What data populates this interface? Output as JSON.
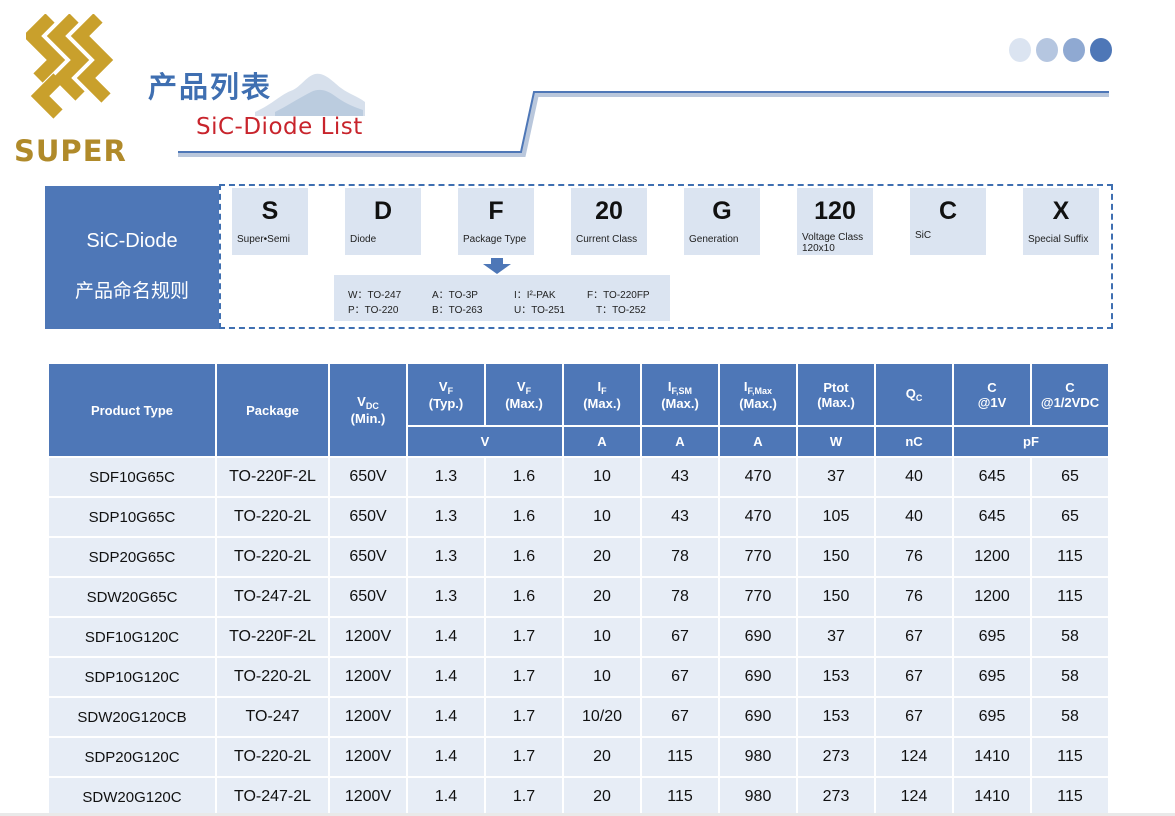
{
  "header": {
    "logo_text": "SUPER",
    "title_cn": "产品列表",
    "title_en": "SiC-Diode  List"
  },
  "colors": {
    "brand_gold": "#c9a02c",
    "primary_blue": "#4e77b7",
    "row_fill": "#e7edf6",
    "title_red": "#c8242c"
  },
  "naming": {
    "label_line1": "SiC-Diode",
    "label_line2": "产品命名规则",
    "codes": [
      {
        "char": "S",
        "desc": "Super•Semi"
      },
      {
        "char": "D",
        "desc": "Diode"
      },
      {
        "char": "F",
        "desc": "Package Type"
      },
      {
        "char": "20",
        "desc": "Current Class"
      },
      {
        "char": "G",
        "desc": "Generation"
      },
      {
        "char": "120",
        "desc": "Voltage Class",
        "desc2": "120x10"
      },
      {
        "char": "C",
        "desc": "SiC"
      },
      {
        "char": "X",
        "desc": "Special Suffix"
      }
    ],
    "packages": [
      "W：TO-247",
      "A：TO-3P",
      "I：I²-PAK",
      "F：TO-220FP",
      "P：TO-220",
      "B：TO-263",
      "U：TO-251",
      "T：TO-252"
    ]
  },
  "table": {
    "headers": {
      "product_type": "Product Type",
      "package": "Package",
      "vdc": {
        "main": "V",
        "sub": "DC",
        "line2": "(Min.)"
      },
      "vf_typ": {
        "main": "V",
        "sub": "F",
        "line2": "(Typ.)"
      },
      "vf_max": {
        "main": "V",
        "sub": "F",
        "line2": "(Max.)"
      },
      "if_max": {
        "main": "I",
        "sub": "F",
        "line2": "(Max.)"
      },
      "ifsm": {
        "main": "I",
        "sub": "F,SM",
        "line2": "(Max.)"
      },
      "ifmax": {
        "main": "I",
        "sub": "F,Max",
        "line2": "(Max.)"
      },
      "ptot": {
        "main": "Ptot",
        "line2": "(Max.)"
      },
      "qc": {
        "main": "Q",
        "sub": "C"
      },
      "c1": {
        "main": "C",
        "line2": "@1V"
      },
      "c2": {
        "main": "C",
        "line2": "@1/2VDC"
      }
    },
    "units": {
      "v": "V",
      "a1": "A",
      "a2": "A",
      "a3": "A",
      "w": "W",
      "nc": "nC",
      "pf": "pF"
    },
    "rows": [
      [
        "SDF10G65C",
        "TO-220F-2L",
        "650V",
        "1.3",
        "1.6",
        "10",
        "43",
        "470",
        "37",
        "40",
        "645",
        "65"
      ],
      [
        "SDP10G65C",
        "TO-220-2L",
        "650V",
        "1.3",
        "1.6",
        "10",
        "43",
        "470",
        "105",
        "40",
        "645",
        "65"
      ],
      [
        "SDP20G65C",
        "TO-220-2L",
        "650V",
        "1.3",
        "1.6",
        "20",
        "78",
        "770",
        "150",
        "76",
        "1200",
        "115"
      ],
      [
        "SDW20G65C",
        "TO-247-2L",
        "650V",
        "1.3",
        "1.6",
        "20",
        "78",
        "770",
        "150",
        "76",
        "1200",
        "115"
      ],
      [
        "SDF10G120C",
        "TO-220F-2L",
        "1200V",
        "1.4",
        "1.7",
        "10",
        "67",
        "690",
        "37",
        "67",
        "695",
        "58"
      ],
      [
        "SDP10G120C",
        "TO-220-2L",
        "1200V",
        "1.4",
        "1.7",
        "10",
        "67",
        "690",
        "153",
        "67",
        "695",
        "58"
      ],
      [
        "SDW20G120CB",
        "TO-247",
        "1200V",
        "1.4",
        "1.7",
        "10/20",
        "67",
        "690",
        "153",
        "67",
        "695",
        "58"
      ],
      [
        "SDP20G120C",
        "TO-220-2L",
        "1200V",
        "1.4",
        "1.7",
        "20",
        "115",
        "980",
        "273",
        "124",
        "1410",
        "115"
      ],
      [
        "SDW20G120C",
        "TO-247-2L",
        "1200V",
        "1.4",
        "1.7",
        "20",
        "115",
        "980",
        "273",
        "124",
        "1410",
        "115"
      ]
    ]
  }
}
